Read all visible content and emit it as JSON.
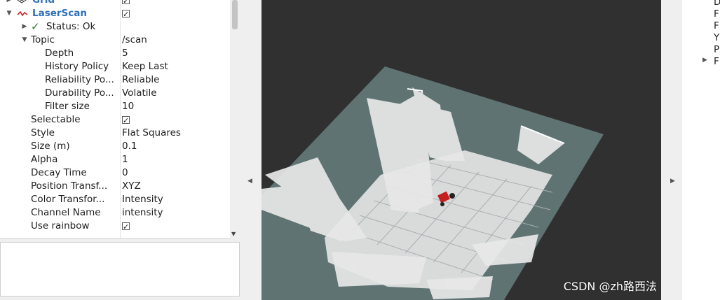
{
  "displays": {
    "rows": [
      {
        "name": "Grid",
        "value": "checkbox",
        "checked": true,
        "indent": 0,
        "arrow": "right",
        "icon": "grid-icon",
        "style": "blue"
      },
      {
        "name": "LaserScan",
        "value": "checkbox",
        "checked": true,
        "indent": 0,
        "arrow": "down",
        "icon": "laserscan-icon",
        "style": "blue"
      },
      {
        "name": "Status: Ok",
        "value": "",
        "indent": 1,
        "arrow": "right",
        "icon": "status-ok-check-icon"
      },
      {
        "name": "Topic",
        "value": "/scan",
        "indent": 1,
        "arrow": "down"
      },
      {
        "name": "Depth",
        "value": "5",
        "indent": 2
      },
      {
        "name": "History Policy",
        "value": "Keep Last",
        "indent": 2
      },
      {
        "name": "Reliability Po...",
        "value": "Reliable",
        "indent": 2
      },
      {
        "name": "Durability Po...",
        "value": "Volatile",
        "indent": 2
      },
      {
        "name": "Filter size",
        "value": "10",
        "indent": 2
      },
      {
        "name": "Selectable",
        "value": "checkbox",
        "checked": true,
        "indent": 1
      },
      {
        "name": "Style",
        "value": "Flat Squares",
        "indent": 1
      },
      {
        "name": "Size (m)",
        "value": "0.1",
        "indent": 1
      },
      {
        "name": "Alpha",
        "value": "1",
        "indent": 1
      },
      {
        "name": "Decay Time",
        "value": "0",
        "indent": 1
      },
      {
        "name": "Position Transf...",
        "value": "XYZ",
        "indent": 1
      },
      {
        "name": "Color Transfor...",
        "value": "Intensity",
        "indent": 1
      },
      {
        "name": "Channel Name",
        "value": "intensity",
        "indent": 1
      },
      {
        "name": "Use rainbow",
        "value": "checkbox",
        "checked": true,
        "indent": 1
      }
    ]
  },
  "right_panel": {
    "items": [
      "D",
      "F",
      "F",
      "Y",
      "P",
      "F"
    ]
  },
  "watermark": "CSDN @zh路西法",
  "colors": {
    "background_3d": "#303030",
    "ground_plane": "#5f7373",
    "scan_points": "#e6e6e6",
    "grid_lines": "#9fa6a6",
    "robot": "#c41e1e",
    "accent_blue": "#2f6fb7"
  },
  "icons": {
    "collapse_left": "triangle-left-icon",
    "collapse_right": "triangle-right-icon"
  }
}
